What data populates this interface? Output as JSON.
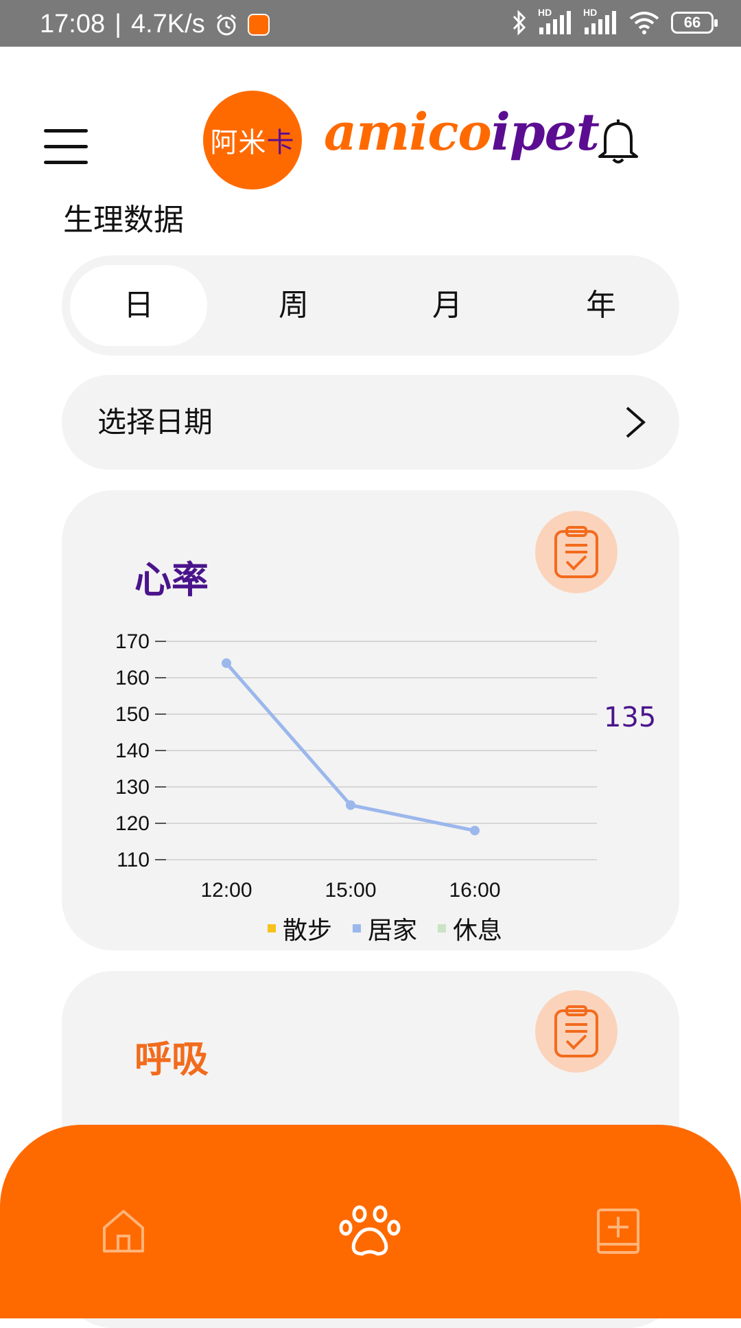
{
  "status_bar": {
    "time": "17:08",
    "separator": "|",
    "net_speed": "4.7K/s",
    "hd1": "HD",
    "hd2": "HD",
    "battery": "66"
  },
  "header": {
    "logo_cn_1": "阿米",
    "logo_cn_2": "卡",
    "logo_text_1": "amico",
    "logo_text_2": "ipet"
  },
  "page_title": "生理数据",
  "period_tabs": [
    {
      "label": "日",
      "selected": true
    },
    {
      "label": "周",
      "selected": false
    },
    {
      "label": "月",
      "selected": false
    },
    {
      "label": "年",
      "selected": false
    }
  ],
  "date_picker": {
    "label": "选择日期"
  },
  "heart_rate_card": {
    "title": "心率",
    "title_color": "#4a148c",
    "current_value": "135"
  },
  "respiration_card": {
    "title": "呼吸",
    "title_color": "#f26b1d"
  },
  "colors": {
    "accent": "#ff6a00",
    "purple": "#5b0d91",
    "clip_bg": "#fbd3bb",
    "line": "#9bb7ec"
  },
  "chart_data": {
    "type": "line",
    "x": [
      "12:00",
      "15:00",
      "16:00"
    ],
    "series": [
      {
        "name": "居家",
        "color": "#9bb7ec",
        "values": [
          164,
          125,
          118
        ]
      }
    ],
    "ylim": [
      110,
      170
    ],
    "yticks": [
      170,
      160,
      150,
      140,
      130,
      120,
      110
    ],
    "grid": true,
    "legend": [
      {
        "label": "散步",
        "color": "#f7c21a"
      },
      {
        "label": "居家",
        "color": "#9bb7ec"
      },
      {
        "label": "休息",
        "color": "#c9e3c4"
      }
    ],
    "legend_position": "bottom",
    "title": "",
    "xlabel": "",
    "ylabel": ""
  },
  "bottom_nav": [
    {
      "name": "home-icon"
    },
    {
      "name": "paw-icon"
    },
    {
      "name": "add-book-icon"
    }
  ]
}
